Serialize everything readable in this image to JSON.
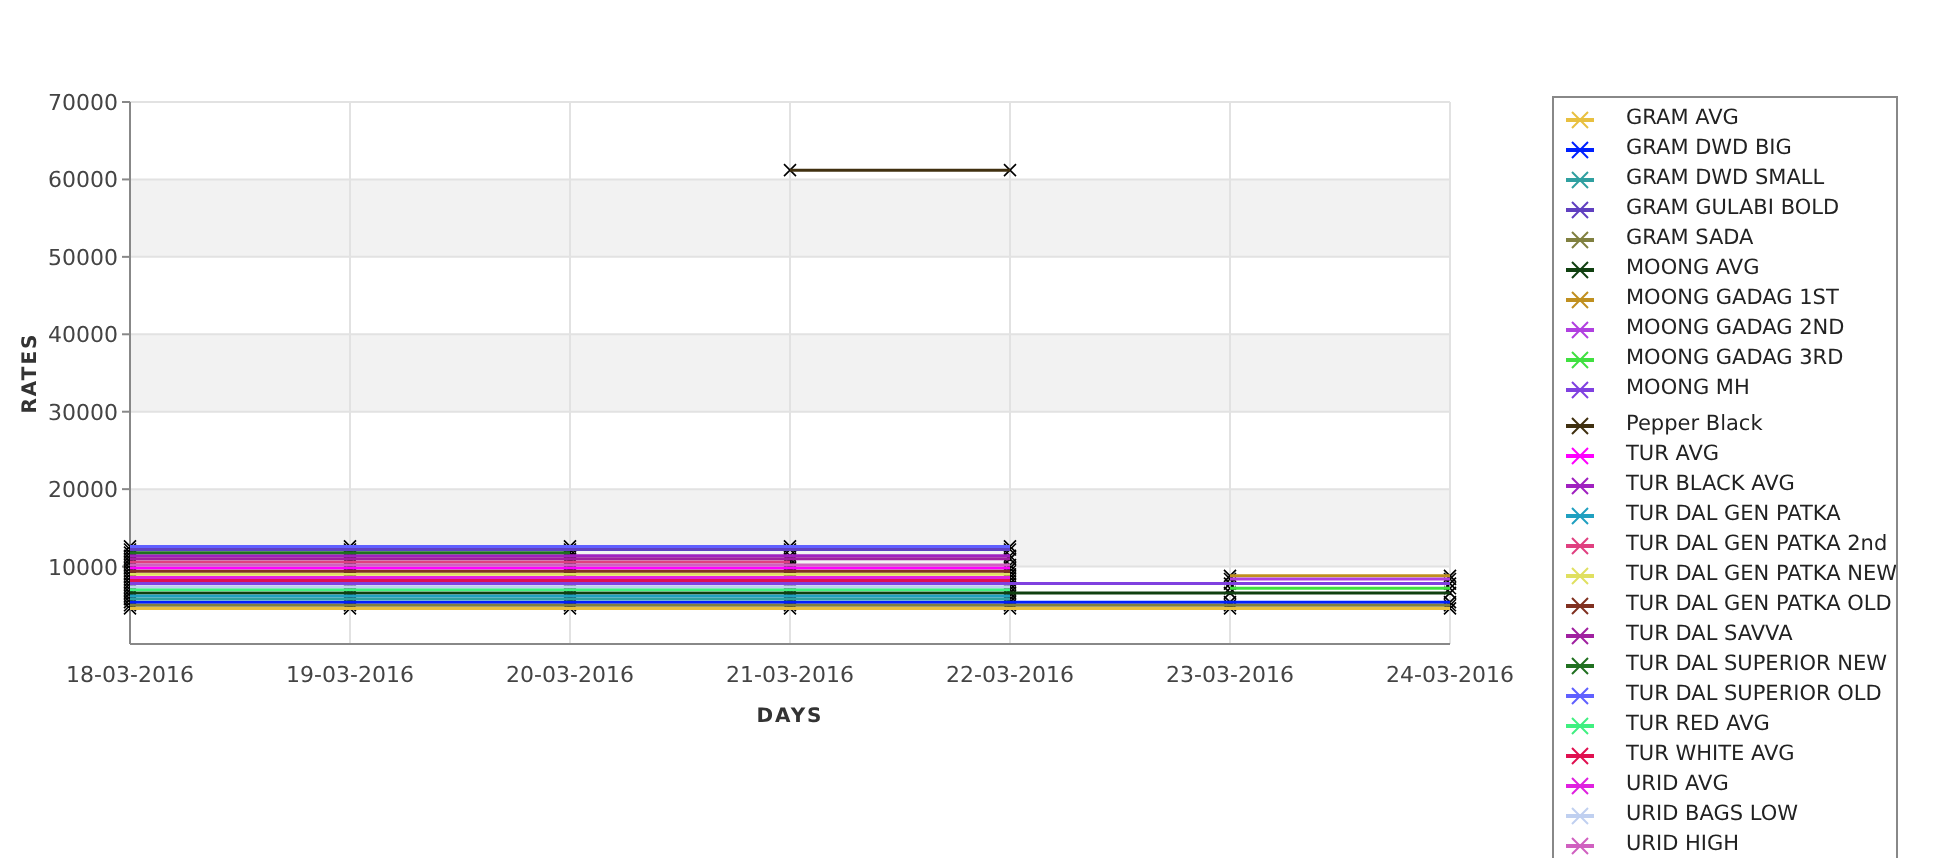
{
  "chart": {
    "chart_data": {
      "type": "line",
      "grid": true,
      "xlabel": "DAYS",
      "ylabel": "RATES",
      "categories": [
        "18-03-2016",
        "19-03-2016",
        "20-03-2016",
        "21-03-2016",
        "22-03-2016",
        "23-03-2016",
        "24-03-2016"
      ],
      "ylim": [
        0,
        70000
      ],
      "yticks": [
        10000,
        20000,
        30000,
        40000,
        50000,
        60000,
        70000
      ],
      "series": [
        {
          "name": "GRAM AVG",
          "color": "#e8c040",
          "marker": "x",
          "values": [
            4600,
            4600,
            4600,
            4600,
            4600,
            4600,
            4600
          ]
        },
        {
          "name": "GRAM DWD BIG",
          "color": "#0020ff",
          "marker": "x",
          "values": [
            5400,
            5400,
            5400,
            5400,
            5400,
            5400,
            5400
          ]
        },
        {
          "name": "GRAM DWD SMALL",
          "color": "#30a0a0",
          "marker": "x",
          "values": [
            5800,
            5800,
            5800,
            5800,
            5800,
            null,
            null
          ]
        },
        {
          "name": "GRAM GULABI BOLD",
          "color": "#6040c0",
          "marker": "x",
          "values": [
            12200,
            12200,
            12200,
            12200,
            12200,
            null,
            null
          ]
        },
        {
          "name": "GRAM SADA",
          "color": "#808040",
          "marker": "x",
          "values": [
            5000,
            5000,
            5000,
            5000,
            5000,
            5000,
            5000
          ]
        },
        {
          "name": "MOONG AVG",
          "color": "#104010",
          "marker": "x",
          "values": [
            6600,
            6600,
            6600,
            6600,
            6600,
            6600,
            6600
          ]
        },
        {
          "name": "MOONG GADAG 1ST",
          "color": "#c09020",
          "marker": "x",
          "values": [
            null,
            null,
            null,
            null,
            null,
            8800,
            8800
          ]
        },
        {
          "name": "MOONG GADAG 2ND",
          "color": "#b040e0",
          "marker": "x",
          "values": [
            null,
            null,
            null,
            null,
            null,
            8400,
            8400
          ]
        },
        {
          "name": "MOONG GADAG 3RD",
          "color": "#40e040",
          "marker": "x",
          "values": [
            null,
            null,
            null,
            null,
            null,
            7200,
            7200
          ]
        },
        {
          "name": "MOONG MH",
          "color": "#8040e0",
          "marker": "x",
          "values": [
            7800,
            7800,
            7800,
            7800,
            7800,
            7800,
            7800
          ]
        },
        {
          "name": "Pepper Black",
          "color": "#403010",
          "marker": "x",
          "values": [
            null,
            null,
            null,
            61200,
            61200,
            null,
            null
          ]
        },
        {
          "name": "TUR AVG",
          "color": "#ff00ff",
          "marker": "x",
          "values": [
            9800,
            9800,
            9800,
            9800,
            9800,
            null,
            null
          ]
        },
        {
          "name": "TUR BLACK AVG",
          "color": "#a020c0",
          "marker": "x",
          "values": [
            11400,
            11400,
            11400,
            11400,
            11400,
            null,
            null
          ]
        },
        {
          "name": "TUR DAL GEN PATKA",
          "color": "#20a0c0",
          "marker": "x",
          "values": [
            6200,
            6200,
            6200,
            6200,
            6200,
            null,
            null
          ]
        },
        {
          "name": "TUR DAL GEN PATKA 2nd",
          "color": "#e04080",
          "marker": "x",
          "values": [
            10600,
            10600,
            10600,
            10600,
            null,
            null,
            null
          ]
        },
        {
          "name": "TUR DAL GEN PATKA NEW",
          "color": "#e0e060",
          "marker": "x",
          "values": [
            9000,
            9000,
            9000,
            9000,
            9000,
            null,
            null
          ]
        },
        {
          "name": "TUR DAL GEN PATKA OLD",
          "color": "#803020",
          "marker": "x",
          "values": [
            9400,
            9400,
            9400,
            9400,
            9400,
            null,
            null
          ]
        },
        {
          "name": "TUR DAL SAVVA",
          "color": "#a020a0",
          "marker": "x",
          "values": [
            11000,
            11000,
            11000,
            11000,
            11000,
            null,
            null
          ]
        },
        {
          "name": "TUR DAL SUPERIOR NEW",
          "color": "#207020",
          "marker": "x",
          "values": [
            11800,
            11800,
            11800,
            null,
            null,
            null,
            null
          ]
        },
        {
          "name": "TUR DAL SUPERIOR OLD",
          "color": "#6060ff",
          "marker": "x",
          "values": [
            12600,
            12600,
            12600,
            12600,
            12600,
            null,
            null
          ]
        },
        {
          "name": "TUR RED AVG",
          "color": "#40f080",
          "marker": "x",
          "values": [
            7000,
            7000,
            7000,
            7000,
            7000,
            null,
            null
          ]
        },
        {
          "name": "TUR WHITE AVG",
          "color": "#e01050",
          "marker": "x",
          "values": [
            8200,
            8200,
            8200,
            8200,
            8200,
            null,
            null
          ]
        },
        {
          "name": "URID AVG",
          "color": "#e020e0",
          "marker": "x",
          "values": [
            8600,
            8600,
            8600,
            8600,
            8600,
            null,
            null
          ]
        },
        {
          "name": "URID BAGS LOW",
          "color": "#c0d0f0",
          "marker": "x",
          "values": [
            7400,
            7400,
            7400,
            7400,
            7400,
            null,
            null
          ]
        },
        {
          "name": "URID HIGH",
          "color": "#d060c0",
          "marker": "x",
          "values": [
            10200,
            10200,
            10200,
            10200,
            10200,
            null,
            null
          ]
        }
      ]
    }
  }
}
